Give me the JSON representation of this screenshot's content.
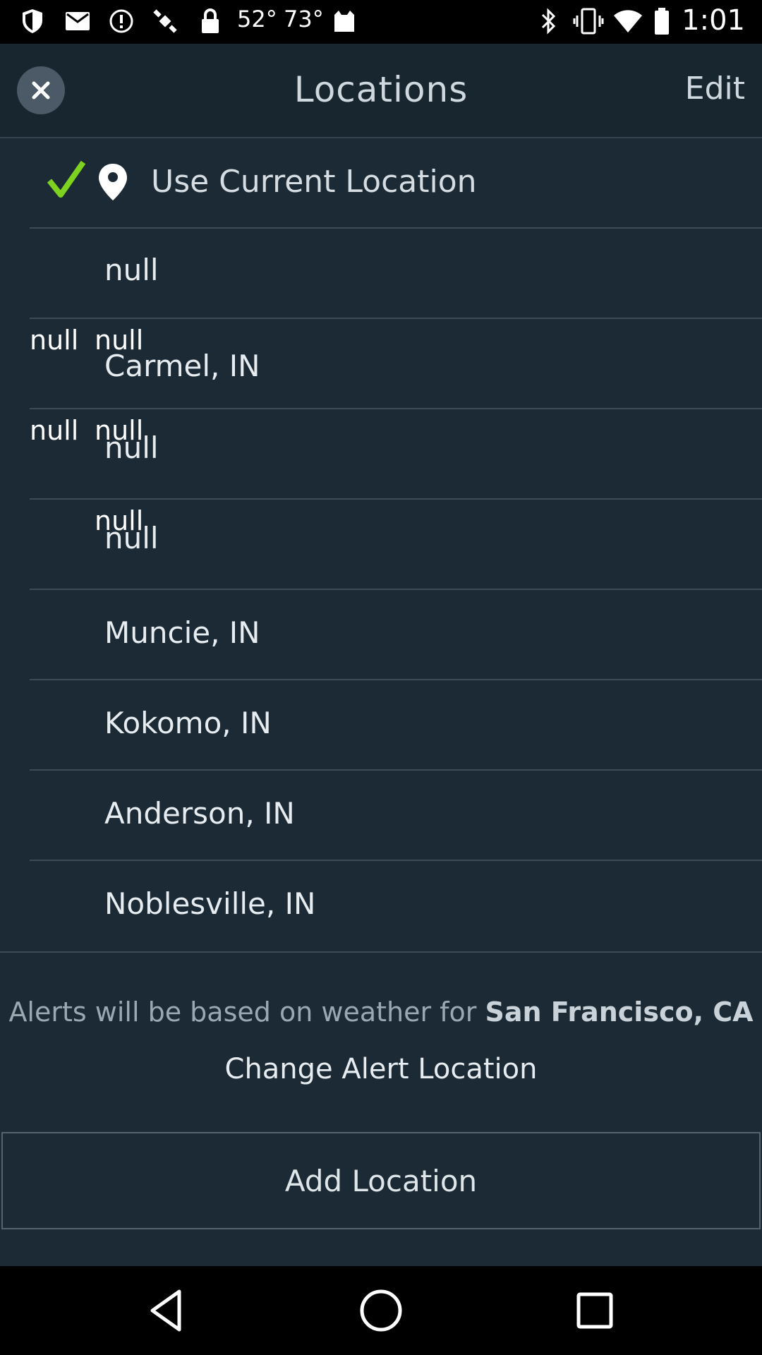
{
  "status_bar": {
    "temps": [
      "52°",
      "73°"
    ],
    "time": "1:01",
    "icons": [
      "shield-icon",
      "gmail-icon",
      "alert-icon",
      "satellite-icon",
      "lock-icon",
      "temp-icon",
      "cat-icon",
      "bluetooth-icon",
      "vibrate-icon",
      "wifi-icon",
      "battery-icon"
    ]
  },
  "header": {
    "title": "Locations",
    "edit_label": "Edit",
    "close_icon": "close-icon"
  },
  "current_location": {
    "label": "Use Current Location",
    "check_color": "#7ed321"
  },
  "locations": [
    {
      "name": "null",
      "left_null": "",
      "sub_null": ""
    },
    {
      "name": "Carmel, IN",
      "left_null": "null",
      "sub_null": "null"
    },
    {
      "name": "null",
      "left_null": "null",
      "sub_null": "null"
    },
    {
      "name": "null",
      "left_null": "",
      "sub_null": "null"
    },
    {
      "name": "Muncie, IN",
      "left_null": "",
      "sub_null": ""
    },
    {
      "name": "Kokomo, IN",
      "left_null": "",
      "sub_null": ""
    },
    {
      "name": "Anderson, IN",
      "left_null": "",
      "sub_null": ""
    },
    {
      "name": "Noblesville, IN",
      "left_null": "",
      "sub_null": ""
    }
  ],
  "footer": {
    "alerts_prefix": "Alerts will be based on weather for ",
    "alerts_location": "San Francisco, CA",
    "change_alert": "Change Alert Location",
    "add_location": "Add Location"
  },
  "nav": {
    "back_icon": "back-icon",
    "home_icon": "home-icon",
    "recents_icon": "recents-icon"
  }
}
